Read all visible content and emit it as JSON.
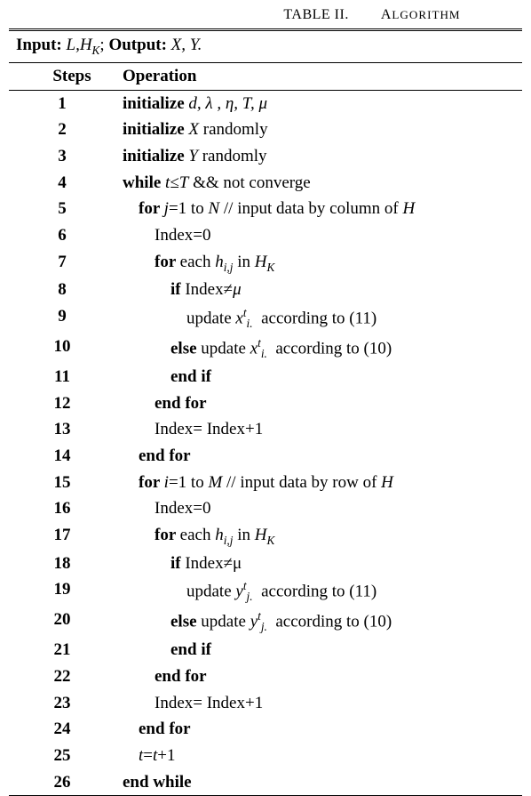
{
  "caption": {
    "label": "TABLE II.",
    "title": "ALGORITHM"
  },
  "input_line": {
    "input_label": "Input:",
    "input_vars": "L,H",
    "input_sub": "K",
    "sep": "; ",
    "output_label": "Output:",
    "output_vars": " X, Y."
  },
  "headers": {
    "steps": "Steps",
    "operation": "Operation"
  },
  "rows": [
    {
      "n": "1",
      "indent": 0,
      "parts": [
        {
          "t": "initialize ",
          "b": true
        },
        {
          "t": "d, λ , η, T, μ",
          "i": true
        }
      ]
    },
    {
      "n": "2",
      "indent": 0,
      "parts": [
        {
          "t": "initialize ",
          "b": true
        },
        {
          "t": "X",
          "i": true
        },
        {
          "t": " randomly"
        }
      ]
    },
    {
      "n": "3",
      "indent": 0,
      "parts": [
        {
          "t": "initialize ",
          "b": true
        },
        {
          "t": "Y",
          "i": true
        },
        {
          "t": " randomly"
        }
      ]
    },
    {
      "n": "4",
      "indent": 0,
      "parts": [
        {
          "t": "while ",
          "b": true
        },
        {
          "t": "t≤T",
          "i": true
        },
        {
          "t": " && not converge"
        }
      ]
    },
    {
      "n": "5",
      "indent": 1,
      "parts": [
        {
          "t": "for ",
          "b": true
        },
        {
          "t": "j",
          "i": true
        },
        {
          "t": "=1 to "
        },
        {
          "t": "N",
          "i": true
        },
        {
          "t": " // input data by column of "
        },
        {
          "t": "H",
          "i": true
        }
      ]
    },
    {
      "n": "6",
      "indent": 2,
      "parts": [
        {
          "t": "Index=0"
        }
      ]
    },
    {
      "n": "7",
      "indent": 2,
      "parts": [
        {
          "t": "for ",
          "b": true
        },
        {
          "t": "each "
        },
        {
          "t": "h",
          "i": true
        },
        {
          "t": "i,j",
          "sub": true
        },
        {
          "t": " in "
        },
        {
          "t": "H",
          "i": true
        },
        {
          "t": "K",
          "sub": true
        }
      ]
    },
    {
      "n": "8",
      "indent": 3,
      "parts": [
        {
          "t": "if ",
          "b": true
        },
        {
          "t": "Index≠"
        },
        {
          "t": "μ",
          "i": true
        }
      ]
    },
    {
      "n": "9",
      "indent": 4,
      "parts": [
        {
          "t": "update "
        },
        {
          "t": "x",
          "i": true
        },
        {
          "t": "t",
          "sup": true
        },
        {
          "t": "i.",
          "sub": true
        },
        {
          "t": "  according to (11)"
        }
      ]
    },
    {
      "n": "10",
      "indent": 3,
      "parts": [
        {
          "t": "else ",
          "b": true
        },
        {
          "t": "update "
        },
        {
          "t": "x",
          "i": true
        },
        {
          "t": "t",
          "sup": true
        },
        {
          "t": "i.",
          "sub": true
        },
        {
          "t": "  according to (10)"
        }
      ]
    },
    {
      "n": "11",
      "indent": 3,
      "parts": [
        {
          "t": "end if",
          "b": true
        }
      ]
    },
    {
      "n": "12",
      "indent": 2,
      "parts": [
        {
          "t": "end for",
          "b": true
        }
      ]
    },
    {
      "n": "13",
      "indent": 2,
      "parts": [
        {
          "t": "Index= Index+1"
        }
      ]
    },
    {
      "n": "14",
      "indent": 1,
      "parts": [
        {
          "t": "end for",
          "b": true
        }
      ]
    },
    {
      "n": "15",
      "indent": 1,
      "parts": [
        {
          "t": "for ",
          "b": true
        },
        {
          "t": "i",
          "i": true
        },
        {
          "t": "=1 to "
        },
        {
          "t": "M",
          "i": true
        },
        {
          "t": " // input data by row of "
        },
        {
          "t": "H",
          "i": true
        }
      ]
    },
    {
      "n": "16",
      "indent": 2,
      "parts": [
        {
          "t": "Index=0"
        }
      ]
    },
    {
      "n": "17",
      "indent": 2,
      "parts": [
        {
          "t": "for ",
          "b": true
        },
        {
          "t": "each "
        },
        {
          "t": "h",
          "i": true
        },
        {
          "t": "i,j",
          "sub": true
        },
        {
          "t": " in "
        },
        {
          "t": "H",
          "i": true
        },
        {
          "t": "K",
          "sub": true
        }
      ]
    },
    {
      "n": "18",
      "indent": 3,
      "parts": [
        {
          "t": "if ",
          "b": true
        },
        {
          "t": "Index≠μ"
        }
      ]
    },
    {
      "n": "19",
      "indent": 4,
      "parts": [
        {
          "t": "update "
        },
        {
          "t": "y",
          "i": true
        },
        {
          "t": "t",
          "sup": true
        },
        {
          "t": "j.",
          "sub": true
        },
        {
          "t": "  according to (11)"
        }
      ]
    },
    {
      "n": "20",
      "indent": 3,
      "parts": [
        {
          "t": "else ",
          "b": true
        },
        {
          "t": "update "
        },
        {
          "t": "y",
          "i": true
        },
        {
          "t": "t",
          "sup": true
        },
        {
          "t": "j.",
          "sub": true
        },
        {
          "t": "  according to (10)"
        }
      ]
    },
    {
      "n": "21",
      "indent": 3,
      "parts": [
        {
          "t": "end if",
          "b": true
        }
      ]
    },
    {
      "n": "22",
      "indent": 2,
      "parts": [
        {
          "t": "end for",
          "b": true
        }
      ]
    },
    {
      "n": "23",
      "indent": 2,
      "parts": [
        {
          "t": "Index= Index+1"
        }
      ]
    },
    {
      "n": "24",
      "indent": 1,
      "parts": [
        {
          "t": "end for",
          "b": true
        }
      ]
    },
    {
      "n": "25",
      "indent": 1,
      "parts": [
        {
          "t": "t",
          "i": true
        },
        {
          "t": "="
        },
        {
          "t": "t",
          "i": true
        },
        {
          "t": "+1"
        }
      ]
    },
    {
      "n": "26",
      "indent": 0,
      "parts": [
        {
          "t": "end while",
          "b": true
        }
      ]
    }
  ]
}
